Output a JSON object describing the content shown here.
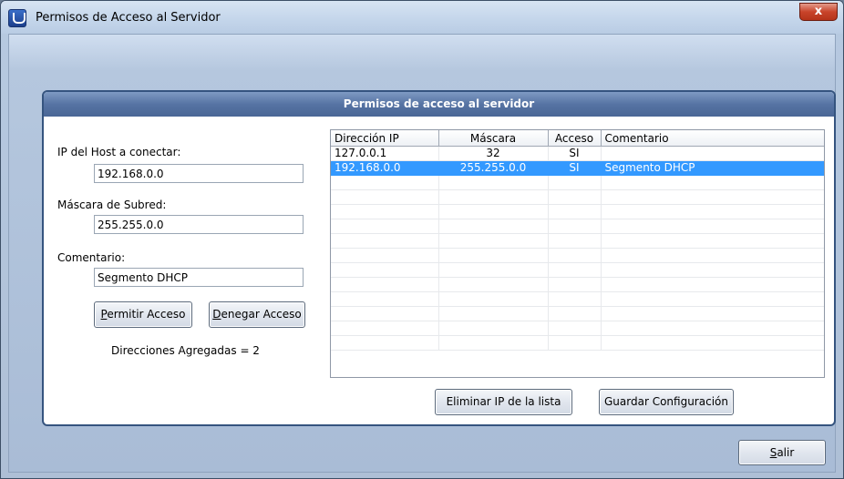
{
  "window": {
    "title": "Permisos de Acceso al Servidor",
    "close_glyph": "x"
  },
  "panel": {
    "header": "Permisos de acceso al servidor"
  },
  "form": {
    "host_label": "IP del Host a conectar:",
    "host_value": "192.168.0.0",
    "mask_label": "Máscara de Subred:",
    "mask_value": "255.255.0.0",
    "comment_label": "Comentario:",
    "comment_value": "Segmento DHCP",
    "allow_button_accel": "P",
    "allow_button_rest": "ermitir Acceso",
    "deny_button_accel": "D",
    "deny_button_rest": "enegar Acceso",
    "count_text": "Direcciones Agregadas = 2"
  },
  "table": {
    "columns": [
      "Dirección IP",
      "Máscara",
      "Acceso",
      "Comentario"
    ],
    "rows": [
      {
        "ip": "127.0.0.1",
        "mask": "32",
        "access": "SI",
        "comment": ""
      },
      {
        "ip": "192.168.0.0",
        "mask": "255.255.0.0",
        "access": "SI",
        "comment": "Segmento DHCP"
      }
    ],
    "selected_row": 1
  },
  "actions": {
    "remove_label": "Eliminar IP de la lista",
    "save_label": "Guardar Configuración",
    "exit_accel": "S",
    "exit_rest": "alir"
  },
  "colors": {
    "selection": "#3399ff",
    "header_bar": "#5673a3"
  },
  "icons": {
    "app": "app-icon",
    "close": "close-icon"
  }
}
